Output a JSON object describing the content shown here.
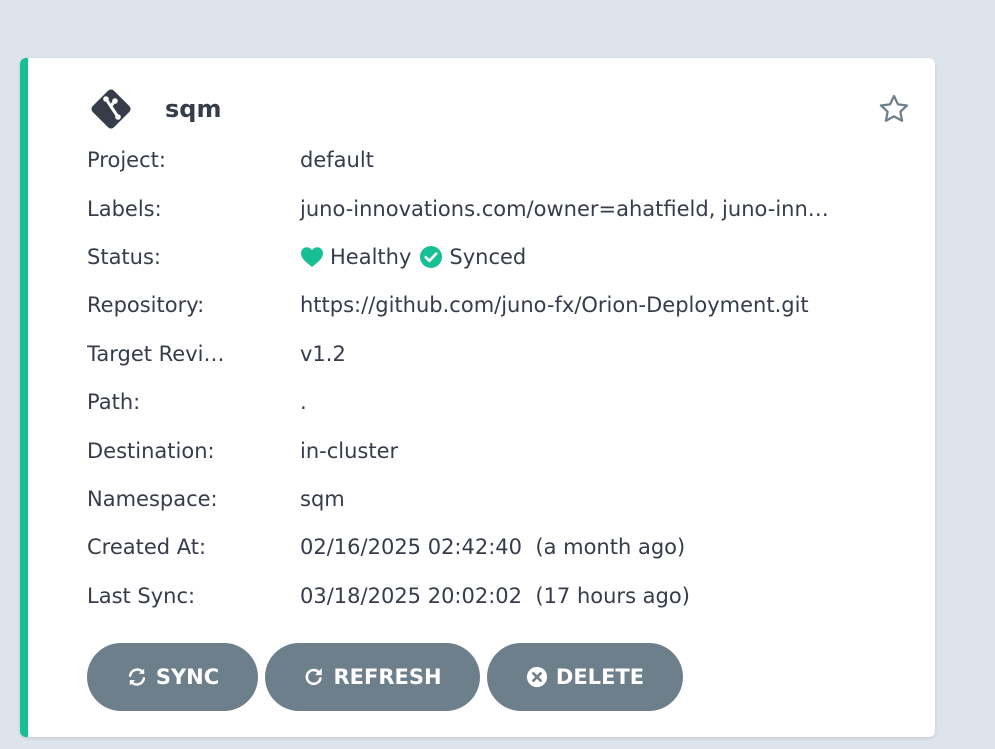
{
  "app": {
    "name": "sqm",
    "favorite_icon": "star-outline-icon",
    "app_icon": "git-diamond-icon"
  },
  "fields": [
    {
      "key": "Project:",
      "value": "default"
    },
    {
      "key": "Labels:",
      "value": "juno-innovations.com/owner=ahatfield, juno-inn…"
    },
    {
      "key": "Status:",
      "health": "Healthy",
      "sync": "Synced"
    },
    {
      "key": "Repository:",
      "value": "https://github.com/juno-fx/Orion-Deployment.git"
    },
    {
      "key": "Target Revi…",
      "value": "v1.2"
    },
    {
      "key": "Path:",
      "value": "."
    },
    {
      "key": "Destination:",
      "value": "in-cluster"
    },
    {
      "key": "Namespace:",
      "value": "sqm"
    },
    {
      "key": "Created At:",
      "value": "02/16/2025 02:42:40  (a month ago)"
    },
    {
      "key": "Last Sync:",
      "value": "03/18/2025 20:02:02  (17 hours ago)"
    }
  ],
  "buttons": {
    "sync": "SYNC",
    "refresh": "REFRESH",
    "delete": "DELETE"
  },
  "colors": {
    "accent": "#18be94",
    "healthy": "#18be94",
    "button": "#6d7f8b",
    "text": "#363c4a",
    "background": "#dee4eb"
  }
}
